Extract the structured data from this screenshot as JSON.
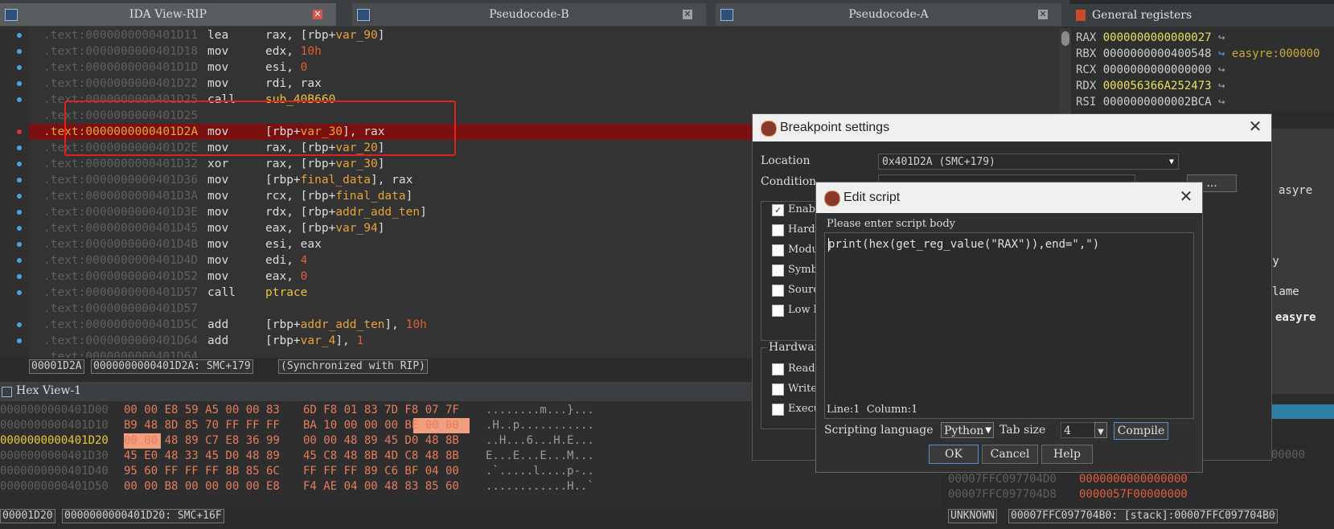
{
  "tabs": [
    {
      "label": "IDA View-RIP",
      "close": "close-icon"
    },
    {
      "label": "Pseudocode-B",
      "close": "close-icon"
    },
    {
      "label": "Pseudocode-A",
      "close": "close-icon"
    }
  ],
  "registers_panel": {
    "title": "General registers",
    "rows": [
      {
        "name": "RAX",
        "value": "0000000000000027",
        "extra": ""
      },
      {
        "name": "RBX",
        "value": "0000000000400548",
        "extra": "easyre:000000"
      },
      {
        "name": "RCX",
        "value": "0000000000000000",
        "extra": ""
      },
      {
        "name": "RDX",
        "value": "000056366A252473",
        "extra": ""
      },
      {
        "name": "RSI",
        "value": "0000000000002BCA",
        "extra": ""
      }
    ]
  },
  "disasm": {
    "lines": [
      {
        "addr": ".text:0000000000401D11",
        "mnem": "lea",
        "ops": [
          "rax, [rbp+",
          "var_90",
          "]"
        ]
      },
      {
        "addr": ".text:0000000000401D18",
        "mnem": "mov",
        "ops": [
          "edx, ",
          "10h",
          ""
        ]
      },
      {
        "addr": ".text:0000000000401D1D",
        "mnem": "mov",
        "ops": [
          "esi, ",
          "0",
          ""
        ]
      },
      {
        "addr": ".text:0000000000401D22",
        "mnem": "mov",
        "ops": [
          "rdi, rax",
          "",
          ""
        ]
      },
      {
        "addr": ".text:0000000000401D25",
        "mnem": "call",
        "ops": [
          "",
          "sub_40B660",
          ""
        ]
      },
      {
        "addr": ".text:0000000000401D25",
        "mnem": "",
        "ops": [
          "",
          "",
          ""
        ]
      },
      {
        "addr": ".text:0000000000401D2A",
        "mnem": "mov",
        "ops": [
          "[rbp+",
          "var_30",
          "], rax"
        ]
      },
      {
        "addr": ".text:0000000000401D2E",
        "mnem": "mov",
        "ops": [
          "rax, [rbp+",
          "var_20",
          "]"
        ]
      },
      {
        "addr": ".text:0000000000401D32",
        "mnem": "xor",
        "ops": [
          "rax, [rbp+",
          "var_30",
          "]"
        ]
      },
      {
        "addr": ".text:0000000000401D36",
        "mnem": "mov",
        "ops": [
          "[rbp+",
          "final_data",
          "], rax"
        ]
      },
      {
        "addr": ".text:0000000000401D3A",
        "mnem": "mov",
        "ops": [
          "rcx, [rbp+",
          "final_data",
          "]"
        ]
      },
      {
        "addr": ".text:0000000000401D3E",
        "mnem": "mov",
        "ops": [
          "rdx, [rbp+",
          "addr_add_ten",
          "]"
        ]
      },
      {
        "addr": ".text:0000000000401D45",
        "mnem": "mov",
        "ops": [
          "eax, [rbp+",
          "var_94",
          "]"
        ]
      },
      {
        "addr": ".text:0000000000401D4B",
        "mnem": "mov",
        "ops": [
          "esi, eax",
          "",
          ""
        ]
      },
      {
        "addr": ".text:0000000000401D4D",
        "mnem": "mov",
        "ops": [
          "edi, ",
          "4",
          ""
        ]
      },
      {
        "addr": ".text:0000000000401D52",
        "mnem": "mov",
        "ops": [
          "eax, ",
          "0",
          ""
        ]
      },
      {
        "addr": ".text:0000000000401D57",
        "mnem": "call",
        "ops": [
          "",
          "ptrace",
          ""
        ]
      },
      {
        "addr": ".text:0000000000401D57",
        "mnem": "",
        "ops": [
          "",
          "",
          ""
        ]
      },
      {
        "addr": ".text:0000000000401D5C",
        "mnem": "add",
        "ops": [
          "[rbp+",
          "addr_add_ten",
          "], 10h"
        ]
      },
      {
        "addr": ".text:0000000000401D64",
        "mnem": "add",
        "ops": [
          "[rbp+",
          "var_4",
          "], 1"
        ]
      },
      {
        "addr": ".text:0000000000401D64",
        "mnem": "",
        "ops": [
          "",
          "",
          ""
        ]
      }
    ],
    "status": [
      "00001D2A",
      "0000000000401D2A: SMC+179",
      "(Synchronized with RIP)"
    ]
  },
  "hexview": {
    "title": "Hex View-1",
    "rows": [
      {
        "addr": "0000000000401D00",
        "b1": "00 00 E8 59 A5 00 00 83",
        "b2": "6D F8 01 83 7D F8 07 7F",
        "ascii": "........m...}..."
      },
      {
        "addr": "0000000000401D10",
        "b1": "B9 48 8D 85 70 FF FF FF",
        "b2": "BA 10 00 00 00 BE 00 00",
        "ascii": ".H..p..........."
      },
      {
        "addr": "0000000000401D20",
        "b1": "00 00 48 89 C7 E8 36 99",
        "b2": "00 00 48 89 45 D0 48 8B",
        "ascii": "..H...6...H.E..."
      },
      {
        "addr": "0000000000401D30",
        "b1": "45 E0 48 33 45 D0 48 89",
        "b2": "45 C8 48 8B 4D C8 48 8B",
        "ascii": "E...E...E...M..."
      },
      {
        "addr": "0000000000401D40",
        "b1": "95 60 FF FF FF 8B 85 6C",
        "b2": "FF FF FF 89 C6 BF 04 00",
        "ascii": ".`.....l....p-.."
      },
      {
        "addr": "0000000000401D50",
        "b1": "00 00 B8 00 00 00 00 E8",
        "b2": "F4 AE 04 00 48 83 85 60",
        "ascii": "............H..`"
      }
    ],
    "status": [
      "00001D20",
      "0000000000401D20: SMC+16F"
    ]
  },
  "stack": {
    "rows": [
      {
        "addr": "00007FFC097704D0",
        "value": "0000000000000000"
      },
      {
        "addr": "00007FFC097704D8",
        "value": "0000057F00000000"
      }
    ],
    "status": [
      "UNKNOWN",
      "00007FFC097704B0: [stack]:00007FFC097704B0"
    ],
    "fragments": [
      "[heap]:0000000"
    ]
  },
  "right_fragments": [
    "asyre",
    "ry",
    "lame",
    "easyre"
  ],
  "bp_dialog": {
    "title": "Breakpoint settings",
    "location_label": "Location",
    "location_value": "0x401D2A (SMC+179)",
    "condition_label": "Condition",
    "checkboxes": [
      {
        "label": "Enabl",
        "checked": true
      },
      {
        "label": "Hardw",
        "checked": false
      },
      {
        "label": "Modul",
        "checked": false
      },
      {
        "label": "Symbo",
        "checked": false
      },
      {
        "label": "Sourc",
        "checked": false
      },
      {
        "label": "Low l",
        "checked": false
      }
    ],
    "hardware_label": "Hardware",
    "hw_checkboxes": [
      {
        "label": "Read",
        "checked": false
      },
      {
        "label": "Write",
        "checked": false
      },
      {
        "label": "Execu",
        "checked": false
      }
    ]
  },
  "script_dialog": {
    "title": "Edit script",
    "prompt": "Please enter script body",
    "code": "print(hex(get_reg_value(\"RAX\")),end=\",\")",
    "position": "Line:1  Column:1",
    "lang_label": "Scripting language",
    "lang_value": "Python",
    "tab_label": "Tab size",
    "tab_value": "4",
    "compile_btn": "Compile",
    "ok_btn": "OK",
    "cancel_btn": "Cancel",
    "help_btn": "Help"
  }
}
